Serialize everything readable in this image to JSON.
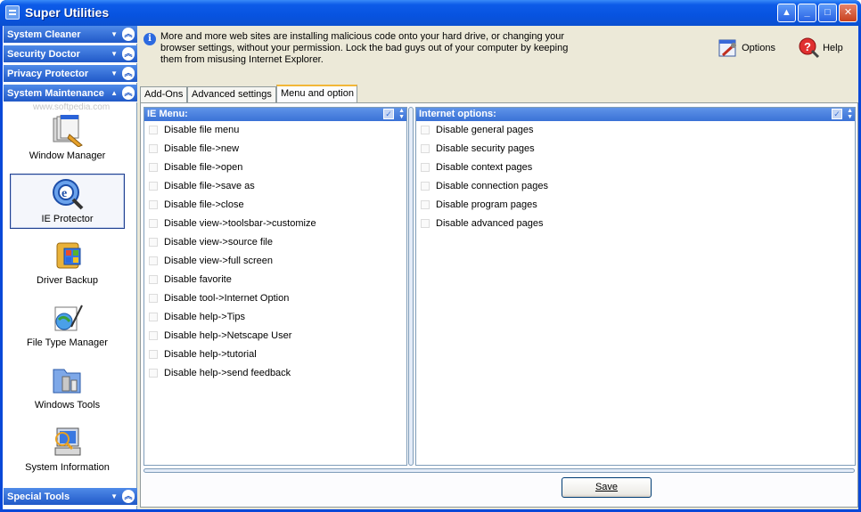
{
  "window": {
    "title": "Super Utilities"
  },
  "sidebar": {
    "categories_top": [
      {
        "label": "System Cleaner"
      },
      {
        "label": "Security Doctor"
      },
      {
        "label": "Privacy Protector"
      },
      {
        "label": "System Maintenance"
      }
    ],
    "watermark": "www.softpedia.com",
    "tools": [
      {
        "label": "Window Manager"
      },
      {
        "label": "IE Protector"
      },
      {
        "label": "Driver Backup"
      },
      {
        "label": "File Type Manager"
      },
      {
        "label": "Windows Tools"
      },
      {
        "label": "System Information"
      }
    ],
    "category_bottom": {
      "label": "Special Tools"
    }
  },
  "header": {
    "info_lines": [
      "More and more web sites are installing malicious code onto your hard drive, or changing your",
      "browser settings, without your permission. Lock the bad guys out of your computer by keeping",
      "them from misusing Internet Explorer."
    ],
    "options_label": "Options",
    "help_label": "Help"
  },
  "tabs": [
    {
      "label": "Add-Ons"
    },
    {
      "label": "Advanced settings"
    },
    {
      "label": "Menu and option"
    }
  ],
  "ie_menu": {
    "title": "IE Menu:",
    "items": [
      "Disable file menu",
      "Disable file->new",
      "Disable file->open",
      "Disable file->save as",
      "Disable file->close",
      "Disable view->toolsbar->customize",
      "Disable view->source file",
      "Disable view->full screen",
      "Disable favorite",
      "Disable tool->Internet Option",
      "Disable help->Tips",
      "Disable help->Netscape User",
      "Disable help->tutorial",
      "Disable help->send feedback"
    ]
  },
  "internet_options": {
    "title": "Internet options:",
    "items": [
      "Disable general pages",
      "Disable security pages",
      "Disable context pages",
      "Disable connection pages",
      "Disable program pages",
      "Disable advanced pages"
    ]
  },
  "save": {
    "label": "Save"
  }
}
